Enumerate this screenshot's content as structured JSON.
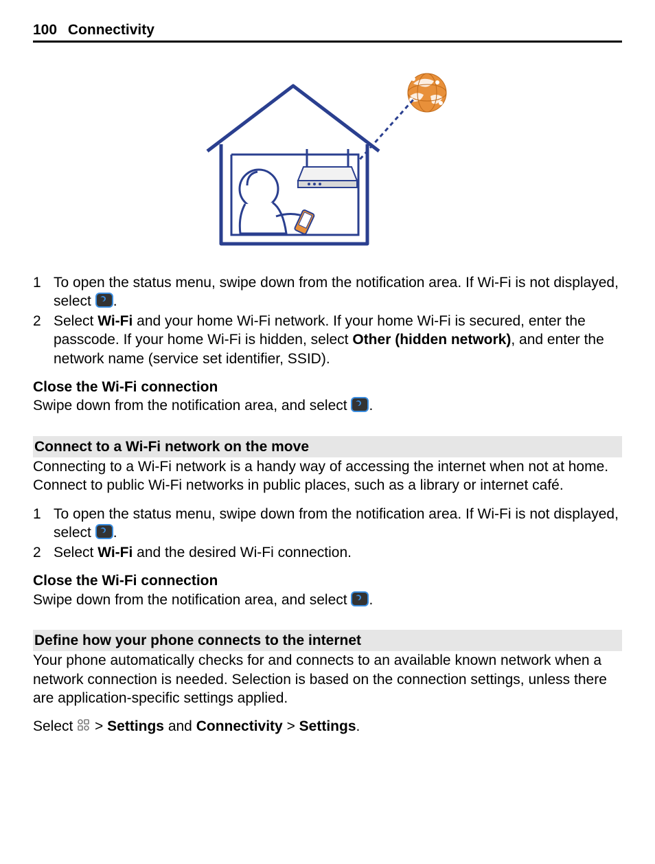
{
  "header": {
    "page_number": "100",
    "section": "Connectivity"
  },
  "steps_a": {
    "s1_a": "To open the status menu, swipe down from the notification area. If Wi-Fi is not displayed, select ",
    "s1_b": ".",
    "s2_a": "Select ",
    "s2_b": "Wi-Fi",
    "s2_c": " and your home Wi-Fi network. If your home Wi-Fi is secured, enter the passcode. If your home Wi-Fi is hidden, select ",
    "s2_d": "Other (hidden network)",
    "s2_e": ", and enter the network name (service set identifier, SSID)."
  },
  "close1": {
    "heading": "Close the Wi-Fi connection",
    "text_a": "Swipe down from the notification area, and select ",
    "text_b": "."
  },
  "section2": {
    "title": "Connect to a Wi-Fi network on the move",
    "intro": "Connecting to a Wi-Fi network is a handy way of accessing the internet when not at home. Connect to public Wi-Fi networks in public places, such as a library or internet café."
  },
  "steps_b": {
    "s1_a": "To open the status menu, swipe down from the notification area. If Wi-Fi is not displayed, select ",
    "s1_b": ".",
    "s2_a": "Select ",
    "s2_b": "Wi-Fi",
    "s2_c": " and the desired Wi-Fi connection."
  },
  "close2": {
    "heading": "Close the Wi-Fi connection",
    "text_a": "Swipe down from the notification area, and select ",
    "text_b": "."
  },
  "section3": {
    "title": "Define how your phone connects to the internet",
    "intro": "Your phone automatically checks for and connects to an available known network when a network connection is needed. Selection is based on the connection settings, unless there are application-specific settings applied.",
    "path_a": "Select ",
    "path_b": " > ",
    "path_c": "Settings",
    "path_d": " and ",
    "path_e": "Connectivity",
    "path_f": " > ",
    "path_g": "Settings",
    "path_h": "."
  }
}
